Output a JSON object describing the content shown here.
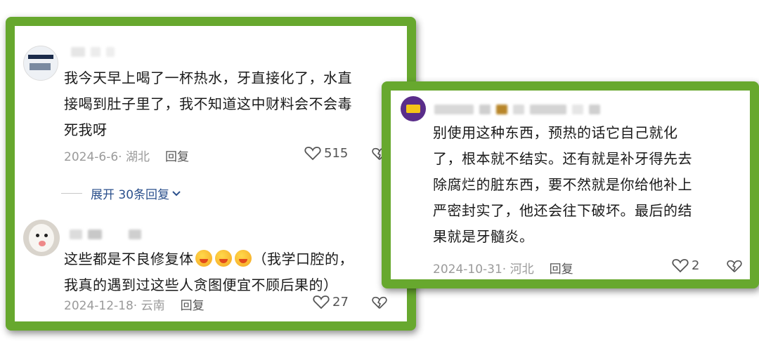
{
  "comments_left": [
    {
      "text": "我今天早上喝了一杯热水，牙直接化了，水直接喝到肚子里了，我不知道这中财料会不会毒死我呀",
      "lines": [
        "我今天早上喝了一杯热水，牙直接化了，水直",
        "接喝到肚子里了，我不知道这中财料会不会毒",
        "死我呀"
      ],
      "date_location": "2024-6-6· 湖北",
      "reply_label": "回复",
      "like_count": "515",
      "expand_label": "展开 30条回复"
    },
    {
      "lines_prefix": "这些都是不良修复体",
      "lines_suffix": "（我学口腔的，",
      "line2": "我真的遇到过这些人贪图便宜不顾后果的）",
      "date_location": "2024-12-18· 云南",
      "reply_label": "回复",
      "like_count": "27"
    }
  ],
  "comment_right": {
    "lines": [
      "别使用这种东西，预热的话它自己就化",
      "了，根本就不结实。还有就是补牙得先去",
      "除腐烂的脏东西，要不然就是你给他补上",
      "严密封实了，他还会往下破坏。最后的结",
      "果就是牙髓炎。"
    ],
    "date_location": "2024-10-31· 河北",
    "reply_label": "回复",
    "like_count": "2"
  },
  "colors": {
    "border": "#67a82e",
    "link": "#2a4f8c",
    "meta": "#9a9a9a"
  },
  "icons": [
    "heart-icon",
    "broken-heart-icon",
    "chevron-down-icon",
    "laughing-emoji"
  ]
}
